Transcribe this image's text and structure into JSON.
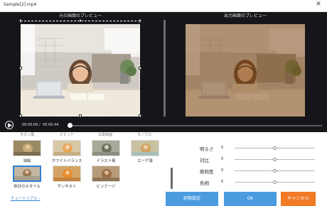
{
  "window": {
    "title": "Sample[2].mp4",
    "close_glyph": "✕"
  },
  "preview": {
    "original_label": "元の画面のプレビュー",
    "output_label": "出力画面のプレビュー"
  },
  "player": {
    "current_time": "00:00:00",
    "separator": "/",
    "total_time": "00:00:44",
    "progress": 0.0
  },
  "filters": {
    "top_row_cut": [
      "ネオン風",
      "ビビッド",
      "白黒映画",
      "モノクロ"
    ],
    "items": [
      {
        "label": "油絵",
        "selected": false
      },
      {
        "label": "ホワイトバランス",
        "selected": false
      },
      {
        "label": "イラスト風",
        "selected": false
      },
      {
        "label": "エーゲ海",
        "selected": false
      },
      {
        "label": "休日のスタイル",
        "selected": true
      },
      {
        "label": "サンキスト",
        "selected": false
      },
      {
        "label": "ビンテージ",
        "selected": false
      }
    ]
  },
  "adjustments": [
    {
      "label": "明るさ",
      "value": "0",
      "level": 0.5
    },
    {
      "label": "対比",
      "value": "0",
      "level": 0.5
    },
    {
      "label": "飽和度",
      "value": "0",
      "level": 0.5
    },
    {
      "label": "色相",
      "value": "0",
      "level": 0.5
    }
  ],
  "footer": {
    "tutorial_link": "チュートリアル ›",
    "reset_button": "初期設定",
    "ok_button": "Ok",
    "cancel_button": "キャンセル"
  },
  "colors": {
    "accent": "#2f7fd8",
    "primary_button": "#4a9be0",
    "cancel_button": "#f07a26",
    "preview_bg": "#16161a"
  }
}
